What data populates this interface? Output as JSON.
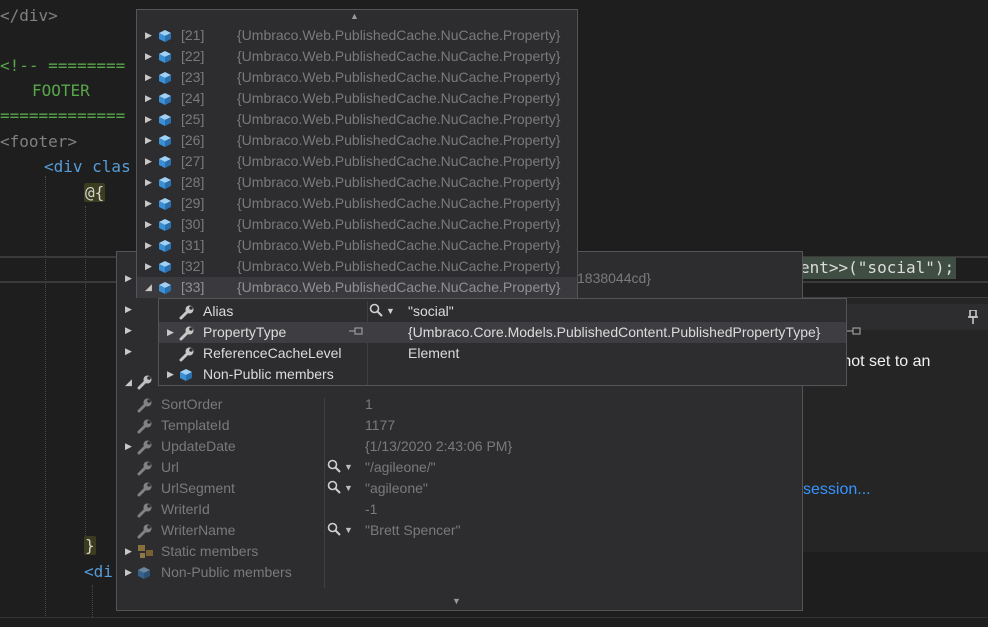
{
  "editor": {
    "lines": [
      {
        "id": "close-div",
        "text": "</div>"
      },
      {
        "id": "comment-open",
        "text": "<!-- ========"
      },
      {
        "id": "footer-label",
        "text": "FOOTER"
      },
      {
        "id": "comment-close",
        "text": "============="
      },
      {
        "id": "footer-tag",
        "text": "<footer>"
      },
      {
        "id": "div-class",
        "text": "<div clas"
      },
      {
        "id": "razor-open",
        "text": "@{"
      },
      {
        "id": "razor-close",
        "text": "}"
      },
      {
        "id": "div-inner",
        "text": "<di"
      }
    ],
    "highlight_text": "ent>>(\"social\");"
  },
  "exception_helper": {
    "message": "e not set to an",
    "link": "session..."
  },
  "array_tip": {
    "rows": [
      {
        "index": "[21]",
        "value": "{Umbraco.Web.PublishedCache.NuCache.Property}"
      },
      {
        "index": "[22]",
        "value": "{Umbraco.Web.PublishedCache.NuCache.Property}"
      },
      {
        "index": "[23]",
        "value": "{Umbraco.Web.PublishedCache.NuCache.Property}"
      },
      {
        "index": "[24]",
        "value": "{Umbraco.Web.PublishedCache.NuCache.Property}"
      },
      {
        "index": "[25]",
        "value": "{Umbraco.Web.PublishedCache.NuCache.Property}"
      },
      {
        "index": "[26]",
        "value": "{Umbraco.Web.PublishedCache.NuCache.Property}"
      },
      {
        "index": "[27]",
        "value": "{Umbraco.Web.PublishedCache.NuCache.Property}"
      },
      {
        "index": "[28]",
        "value": "{Umbraco.Web.PublishedCache.NuCache.Property}"
      },
      {
        "index": "[29]",
        "value": "{Umbraco.Web.PublishedCache.NuCache.Property}"
      },
      {
        "index": "[30]",
        "value": "{Umbraco.Web.PublishedCache.NuCache.Property}"
      },
      {
        "index": "[31]",
        "value": "{Umbraco.Web.PublishedCache.NuCache.Property}"
      },
      {
        "index": "[32]",
        "value": "{Umbraco.Web.PublishedCache.NuCache.Property}"
      },
      {
        "index": "[33]",
        "value": "{Umbraco.Web.PublishedCache.NuCache.Property}"
      }
    ],
    "selected_index": 12
  },
  "property_tip": {
    "rows": [
      {
        "name": "Alias",
        "value": "\"social\"",
        "magnifier": true,
        "expandable": false
      },
      {
        "name": "PropertyType",
        "value": "{Umbraco.Core.Models.PublishedContent.PublishedPropertyType}",
        "magnifier": false,
        "expandable": true,
        "selected": true
      },
      {
        "name": "ReferenceCacheLevel",
        "value": "Element",
        "magnifier": false,
        "expandable": false
      },
      {
        "name": "Non-Public members",
        "value": "",
        "magnifier": false,
        "expandable": true
      }
    ]
  },
  "main_tip": {
    "partial_value": "1838044cd}",
    "rows": [
      {
        "name": "SortOrder",
        "value": "1",
        "magnifier": false,
        "expandable": false,
        "icon": "wrench"
      },
      {
        "name": "TemplateId",
        "value": "1177",
        "magnifier": false,
        "expandable": false,
        "icon": "wrench"
      },
      {
        "name": "UpdateDate",
        "value": "{1/13/2020 2:43:06 PM}",
        "magnifier": false,
        "expandable": true,
        "icon": "wrench"
      },
      {
        "name": "Url",
        "value": "\"/agileone/\"",
        "magnifier": true,
        "expandable": false,
        "icon": "wrench"
      },
      {
        "name": "UrlSegment",
        "value": "\"agileone\"",
        "magnifier": true,
        "expandable": false,
        "icon": "wrench"
      },
      {
        "name": "WriterId",
        "value": "-1",
        "magnifier": false,
        "expandable": false,
        "icon": "wrench"
      },
      {
        "name": "WriterName",
        "value": "\"Brett Spencer\"",
        "magnifier": true,
        "expandable": false,
        "icon": "wrench"
      },
      {
        "name": "Static members",
        "value": "",
        "magnifier": false,
        "expandable": true,
        "icon": "static"
      },
      {
        "name": "Non-Public members",
        "value": "",
        "magnifier": false,
        "expandable": true,
        "icon": "cube"
      }
    ]
  },
  "icons": {
    "wrench": "wrench-icon",
    "cube": "cube-icon",
    "static": "static-members-icon",
    "magnifier": "magnifier-icon",
    "pin": "pin-icon"
  },
  "colors": {
    "tip_bg": "#2d2d30",
    "tip_border": "#555558",
    "text": "#dcdcdc",
    "dim_text": "#7a7a7a",
    "link": "#3794ff",
    "cube": "#4fa3e0"
  }
}
